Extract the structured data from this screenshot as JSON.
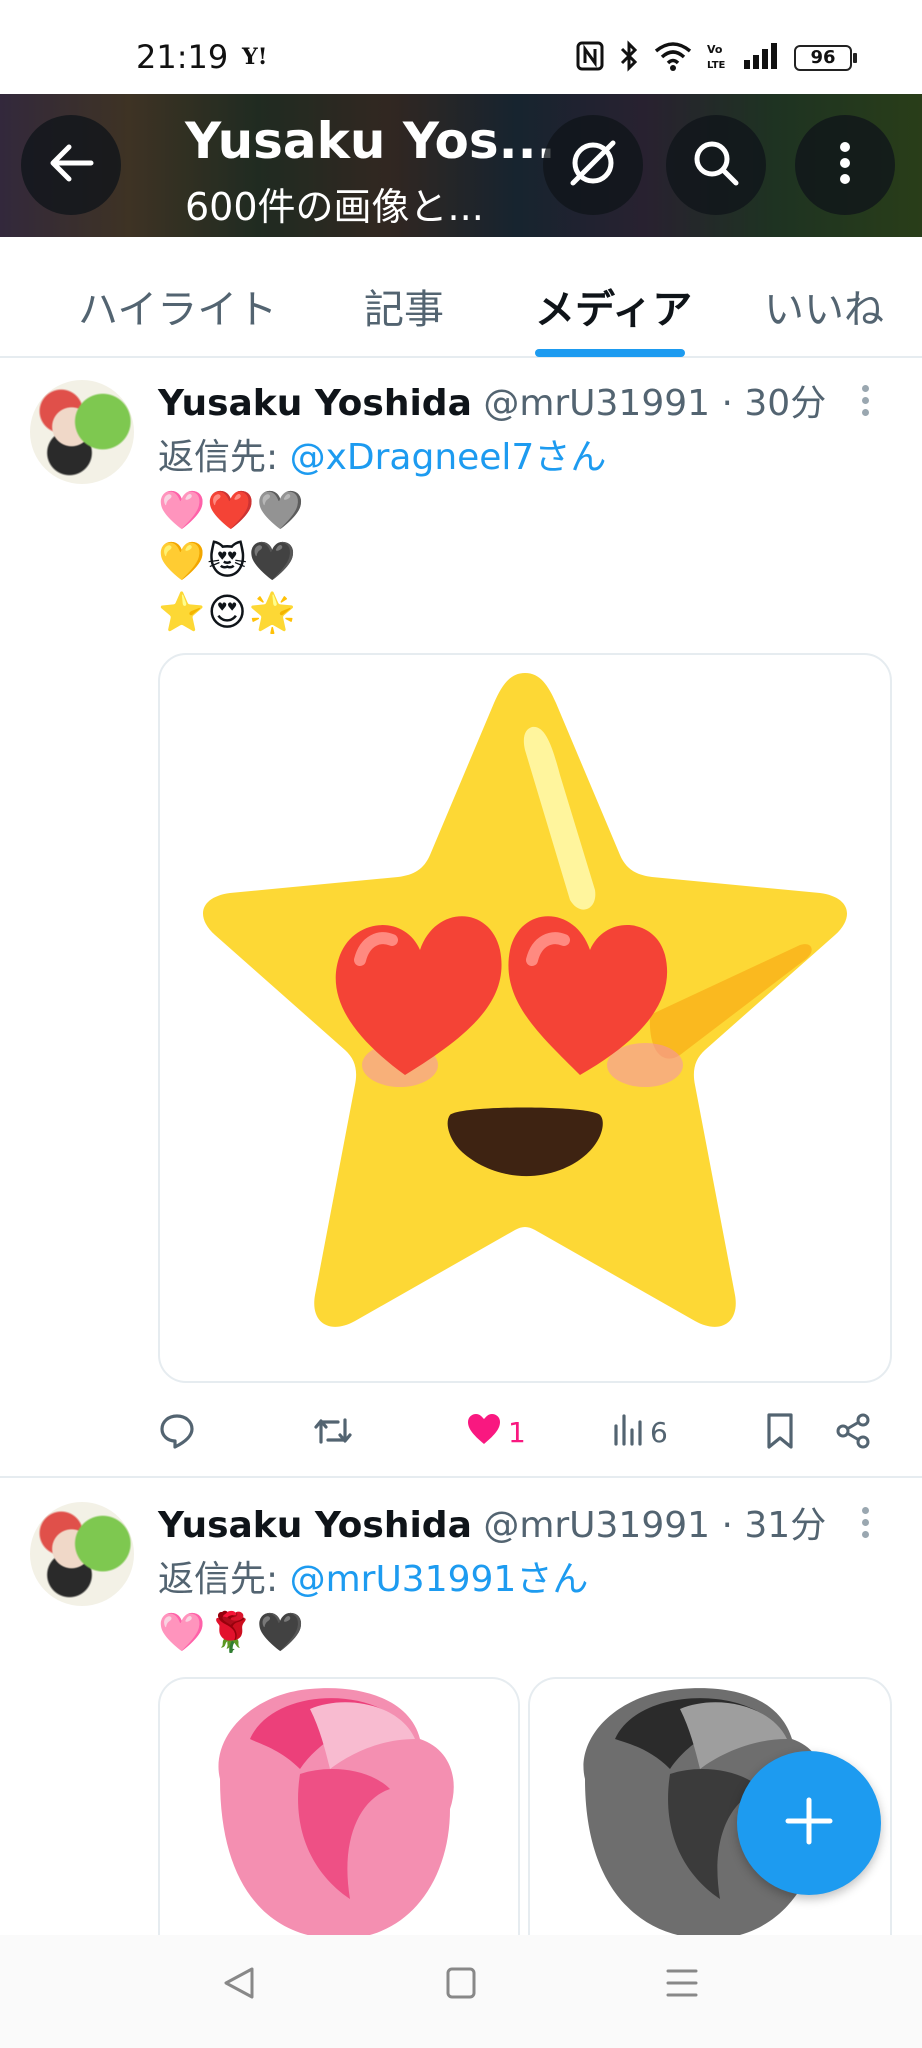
{
  "status_bar": {
    "time": "21:19",
    "carrier_icon": "Y!",
    "battery": "96",
    "icons": [
      "nfc-icon",
      "bluetooth-icon",
      "wifi-icon",
      "volte-icon",
      "signal-icon",
      "battery-icon"
    ]
  },
  "header": {
    "title": "Yusaku Yos...",
    "subtitle": "600件の画像と...",
    "icons": [
      "back-arrow-icon",
      "grok-icon",
      "search-icon",
      "more-vertical-icon"
    ]
  },
  "tabs": [
    {
      "label": "ハイライト",
      "active": false
    },
    {
      "label": "記事",
      "active": false
    },
    {
      "label": "メディア",
      "active": true
    },
    {
      "label": "いいね",
      "active": false
    }
  ],
  "tweets": [
    {
      "name": "Yusaku Yoshida",
      "meta": "@mrU31991 · 30分",
      "reply_prefix": "返信先: ",
      "reply_to": "@xDragneel7さん",
      "lines": [
        "🩷❤️🩶",
        "💛😻🖤",
        "⭐😍🌟"
      ],
      "media": [
        "star-heart-eyes-emoji"
      ],
      "actions": {
        "reply": "",
        "retweet": "",
        "likes": "1",
        "views": "6"
      }
    },
    {
      "name": "Yusaku Yoshida",
      "meta": "@mrU31991 · 31分",
      "reply_prefix": "返信先: ",
      "reply_to": "@mrU31991さん",
      "lines": [
        "🩷🌹🖤"
      ],
      "media": [
        "pink-rose-emoji",
        "black-rose-emoji"
      ]
    }
  ],
  "colors": {
    "accent": "#1d9bf0",
    "like": "#f91880",
    "text": "#0f1419",
    "secondary": "#536471"
  }
}
